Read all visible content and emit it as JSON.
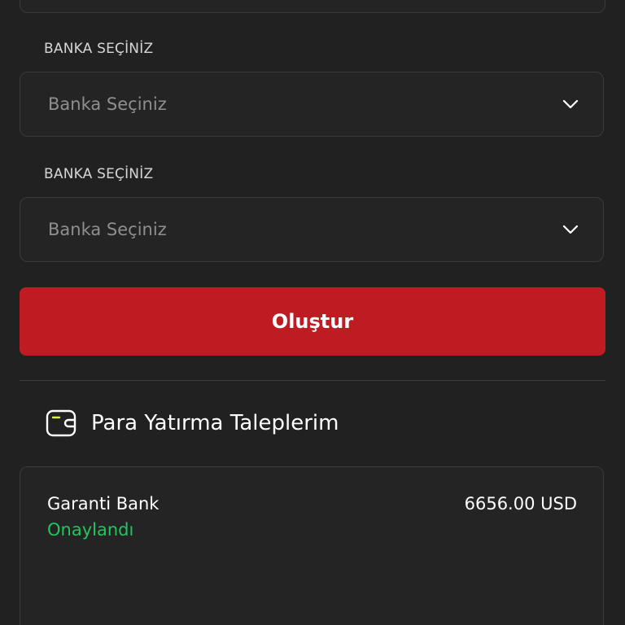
{
  "form": {
    "bank_select_1": {
      "label": "BANKA SEÇİNİZ",
      "placeholder": "Banka Seçiniz"
    },
    "bank_select_2": {
      "label": "BANKA SEÇİNİZ",
      "placeholder": "Banka Seçiniz"
    },
    "submit_label": "Oluştur"
  },
  "deposits": {
    "title": "Para Yatırma Taleplerim",
    "icon": "wallet-icon",
    "items": [
      {
        "bank": "Garanti Bank",
        "status": "Onaylandı",
        "amount": "6656.00 USD"
      }
    ]
  },
  "colors": {
    "background": "#212121",
    "accent": "#be1b23",
    "success": "#22c55e",
    "border": "#3a3a3a"
  }
}
